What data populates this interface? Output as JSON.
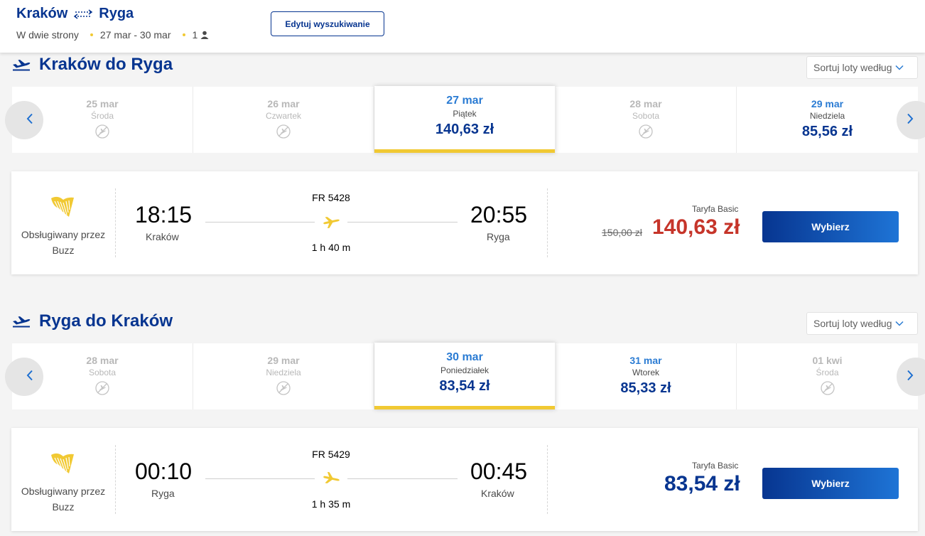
{
  "header": {
    "origin": "Kraków",
    "destination": "Ryga",
    "trip_type": "W dwie strony",
    "dates": "27 mar - 30 mar",
    "passengers": "1",
    "edit_button": "Edytuj wyszukiwanie"
  },
  "sort_label": "Sortuj loty według",
  "outbound": {
    "title": "Kraków do Ryga",
    "days": [
      {
        "date": "25 mar",
        "weekday": "Środa",
        "price": null
      },
      {
        "date": "26 mar",
        "weekday": "Czwartek",
        "price": null
      },
      {
        "date": "27 mar",
        "weekday": "Piątek",
        "price": "140,63 zł",
        "selected": true
      },
      {
        "date": "28 mar",
        "weekday": "Sobota",
        "price": null
      },
      {
        "date": "29 mar",
        "weekday": "Niedziela",
        "price": "85,56 zł"
      }
    ],
    "flight": {
      "operator": "Obsługiwany przez Buzz",
      "flight_no": "FR 5428",
      "dep_time": "18:15",
      "dep_city": "Kraków",
      "arr_time": "20:55",
      "arr_city": "Ryga",
      "duration": "1 h 40 m",
      "fare_label": "Taryfa Basic",
      "old_price": "150,00 zł",
      "price": "140,63 zł",
      "button": "Wybierz"
    }
  },
  "inbound": {
    "title": "Ryga do Kraków",
    "days": [
      {
        "date": "28 mar",
        "weekday": "Sobota",
        "price": null
      },
      {
        "date": "29 mar",
        "weekday": "Niedziela",
        "price": null
      },
      {
        "date": "30 mar",
        "weekday": "Poniedziałek",
        "price": "83,54 zł",
        "selected": true
      },
      {
        "date": "31 mar",
        "weekday": "Wtorek",
        "price": "85,33 zł"
      },
      {
        "date": "01 kwi",
        "weekday": "Środa",
        "price": null
      }
    ],
    "flight": {
      "operator": "Obsługiwany przez Buzz",
      "flight_no": "FR 5429",
      "dep_time": "00:10",
      "dep_city": "Ryga",
      "arr_time": "00:45",
      "arr_city": "Kraków",
      "duration": "1 h 35 m",
      "fare_label": "Taryfa Basic",
      "price": "83,54 zł",
      "button": "Wybierz"
    }
  },
  "colors": {
    "brand_blue": "#073590",
    "accent_yellow": "#f1c933",
    "price_red": "#c6352a",
    "date_blue": "#2a7bd3"
  },
  "icons": [
    "swap-arrows-icon",
    "passenger-icon",
    "plane-takeoff-icon",
    "no-flight-icon",
    "chevron-left-icon",
    "chevron-right-icon",
    "chevron-down-icon",
    "harp-logo",
    "plane-icon"
  ]
}
